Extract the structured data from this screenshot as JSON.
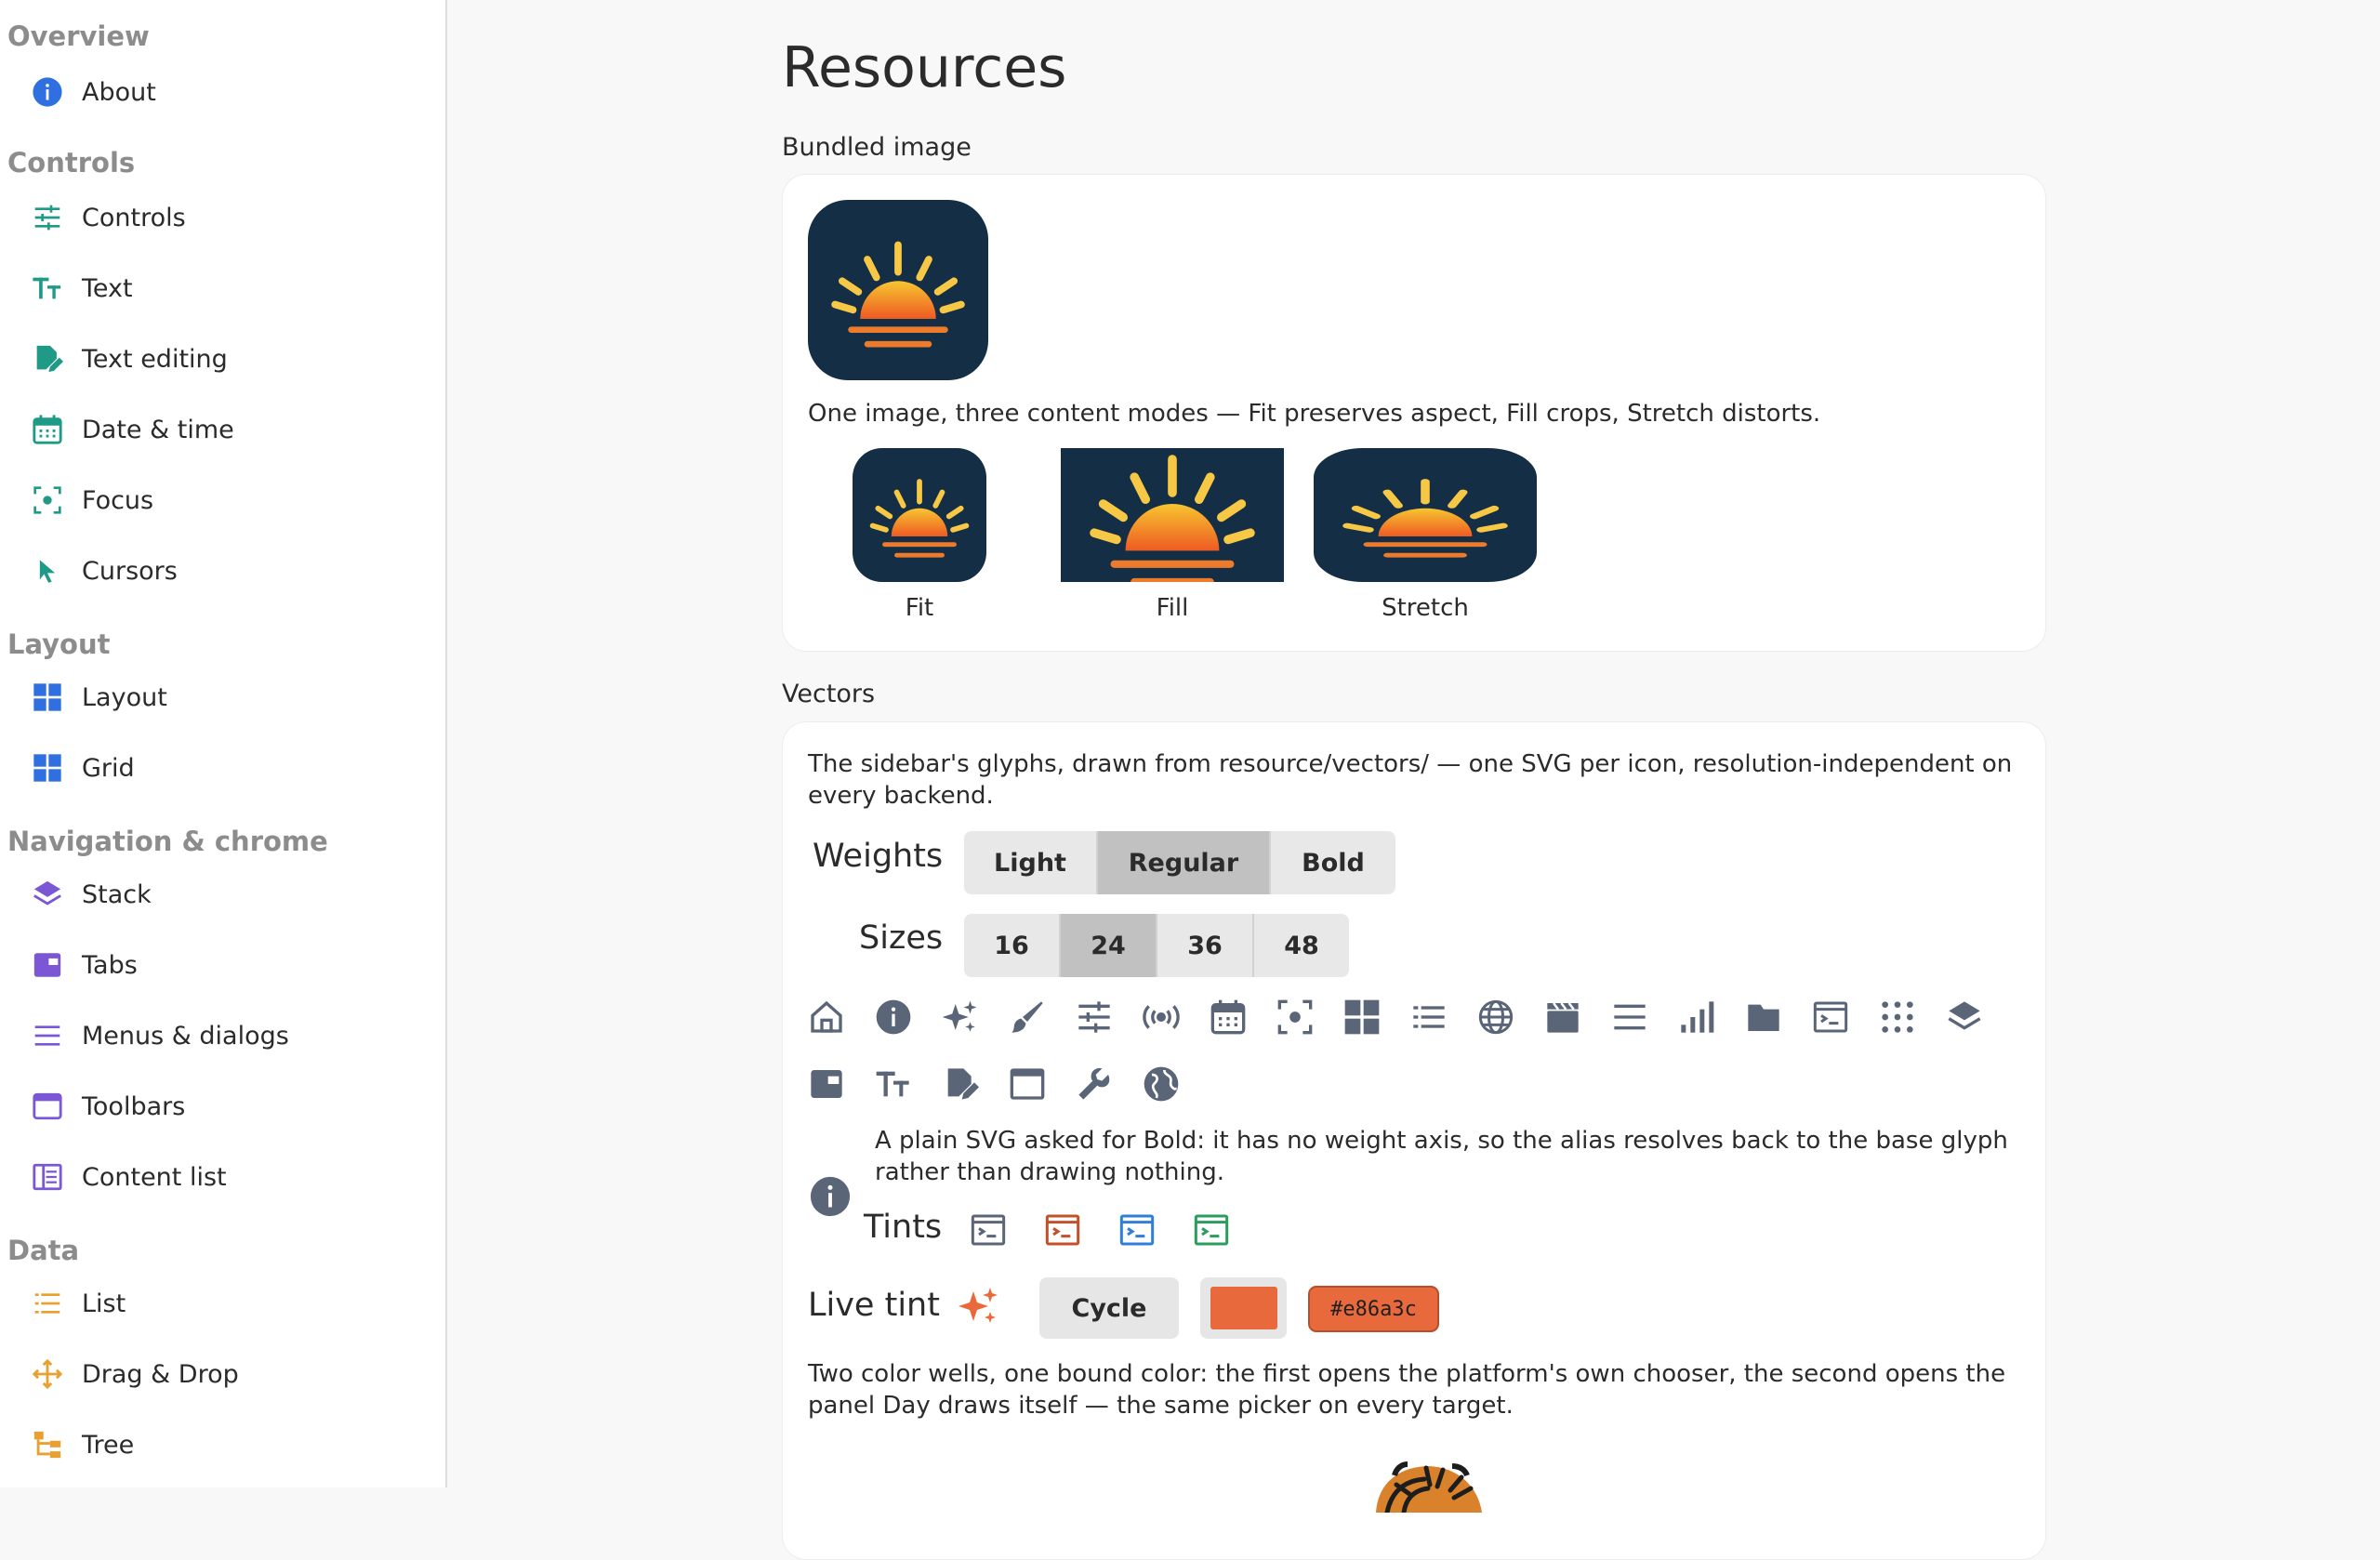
{
  "sidebar": {
    "sections": [
      {
        "label": "Overview"
      },
      {
        "label": "Controls"
      },
      {
        "label": "Layout"
      },
      {
        "label": "Navigation & chrome"
      },
      {
        "label": "Data"
      }
    ],
    "items": [
      {
        "label": "About",
        "icon": "info-icon"
      },
      {
        "label": "Controls",
        "icon": "sliders-icon"
      },
      {
        "label": "Text",
        "icon": "text-size-icon"
      },
      {
        "label": "Text editing",
        "icon": "document-edit-icon"
      },
      {
        "label": "Date & time",
        "icon": "calendar-icon"
      },
      {
        "label": "Focus",
        "icon": "focus-icon"
      },
      {
        "label": "Cursors",
        "icon": "cursor-icon"
      },
      {
        "label": "Layout",
        "icon": "grid-icon"
      },
      {
        "label": "Grid",
        "icon": "grid-icon"
      },
      {
        "label": "Stack",
        "icon": "layers-icon"
      },
      {
        "label": "Tabs",
        "icon": "tabs-icon"
      },
      {
        "label": "Menus & dialogs",
        "icon": "menu-icon"
      },
      {
        "label": "Toolbars",
        "icon": "window-icon"
      },
      {
        "label": "Content list",
        "icon": "content-list-icon"
      },
      {
        "label": "List",
        "icon": "list-icon"
      },
      {
        "label": "Drag & Drop",
        "icon": "move-icon"
      },
      {
        "label": "Tree",
        "icon": "tree-icon"
      }
    ],
    "colors": {
      "overview": "#2f6fdf",
      "controls": "#1f9a86",
      "layout": "#2f6fdf",
      "navigation": "#7b57d6",
      "data": "#e8a030"
    }
  },
  "main": {
    "title": "Resources",
    "bundled": {
      "heading": "Bundled image",
      "description": "One image, three content modes — Fit preserves aspect, Fill crops, Stretch distorts.",
      "modes": [
        "Fit",
        "Fill",
        "Stretch"
      ]
    },
    "vectors": {
      "heading": "Vectors",
      "description": "The sidebar's glyphs, drawn from resource/vectors/ — one SVG per icon, resolution-independent on every backend.",
      "weights_label": "Weights",
      "weights": [
        "Light",
        "Regular",
        "Bold"
      ],
      "weights_selected": "Regular",
      "sizes_label": "Sizes",
      "sizes": [
        "16",
        "24",
        "36",
        "48"
      ],
      "sizes_selected": "24",
      "glyphs": [
        "home-icon",
        "info-icon",
        "sparkles-icon",
        "brush-icon",
        "sliders-icon",
        "broadcast-icon",
        "calendar-icon",
        "focus-icon",
        "grid-icon",
        "list-icon",
        "globe-icon",
        "clapperboard-icon",
        "menu-icon",
        "bar-chart-icon",
        "folder-icon",
        "terminal-icon",
        "apps-icon",
        "layers-icon",
        "tabs-icon",
        "text-size-icon",
        "document-edit-icon",
        "window-icon",
        "wrench-icon",
        "globe-filled-icon"
      ],
      "note": "A plain SVG asked for Bold: it has no weight axis, so the alias resolves back to the base glyph rather than drawing nothing.",
      "tints_label": "Tints",
      "tints": [
        "#5a6577",
        "#c4502a",
        "#2f7fd8",
        "#2a9d5c"
      ],
      "live_tint_label": "Live tint",
      "cycle_label": "Cycle",
      "tint_color": "#e86a3c",
      "tint_hex": "#e86a3c",
      "wells_description": "Two color wells, one bound color: the first opens the platform's own chooser, the second opens the panel Day draws itself — the same picker on every target."
    }
  }
}
